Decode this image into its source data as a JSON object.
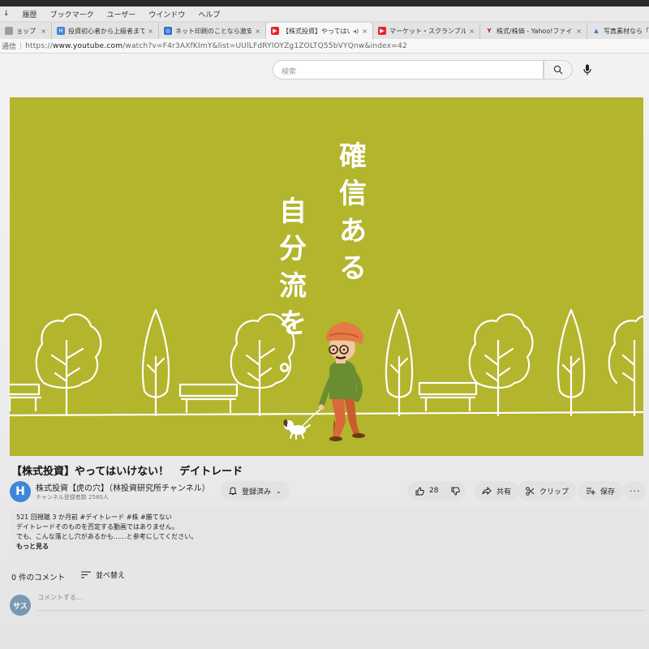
{
  "menubar": {
    "items": [
      "↓",
      "履歴",
      "ブックマーク",
      "ユーザー",
      "ウインドウ",
      "ヘルプ"
    ]
  },
  "tabs": [
    {
      "title": "ョップ - 林投資",
      "favicon": "page-icon",
      "color": "#9c9c9c"
    },
    {
      "title": "投資初心者から上級者まで投",
      "favicon": "h-icon",
      "color": "#3e86d9"
    },
    {
      "title": "ネット印刷のことなら激安",
      "favicon": "swirl-icon",
      "color": "#2f6fd0"
    },
    {
      "title": "【株式投資】やってはいけ",
      "favicon": "youtube-icon",
      "color": "#e22"
    },
    {
      "title": "マーケット・スクランブル",
      "favicon": "youtube-icon",
      "color": "#e22"
    },
    {
      "title": "株式/株価 - Yahoo!ファイナ",
      "favicon": "yahoo-icon",
      "color": "#c00"
    },
    {
      "title": "写真素材なら「",
      "favicon": "a-icon",
      "color": "#2a7bd6"
    }
  ],
  "addressbar": {
    "security": "通信",
    "scheme": "https://",
    "host": "www.youtube.com",
    "path": "/watch?v=F4r3AXfKImY&list=UUlLFdRYlOYZg1ZOLTQ55bVYQnw&index=42"
  },
  "search": {
    "placeholder": "検索"
  },
  "video": {
    "caption_col1": [
      "確",
      "信",
      "あ",
      "る"
    ],
    "caption_col2": [
      "自",
      "分",
      "流",
      "を",
      "。"
    ]
  },
  "meta": {
    "title": "【株式投資】やってはいけない！　デイトレード",
    "channel_name": "株式投資【虎の穴】（林投資研究所チャンネル）",
    "subscribers": "チャンネル登録者数 2580人",
    "subscribe_label": "登録済み",
    "like_count": "28",
    "share_label": "共有",
    "clip_label": "クリップ",
    "save_label": "保存"
  },
  "description": {
    "stats": "521 回視聴  3 か月前  #デイトレード #株 #勝てない",
    "line1": "デイトレードそのものを否定する動画ではありません。",
    "line2": "でも、こんな落とし穴があるかも……と参考にしてください。",
    "more": "もっと見る"
  },
  "comments": {
    "count_label": "0 件のコメント",
    "sort_label": "並べ替え",
    "avatar_initials": "サス",
    "placeholder": "コメントする..."
  }
}
